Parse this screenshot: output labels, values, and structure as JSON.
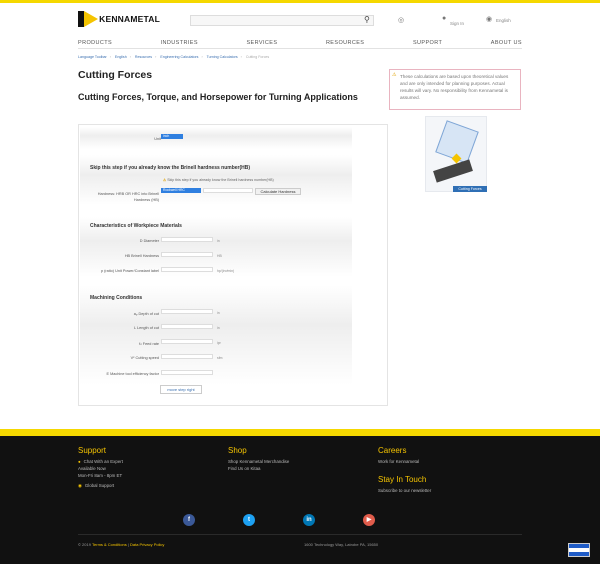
{
  "header": {
    "logo_text": "KENNAMETAL",
    "icon1_label": "",
    "sign_in": "Sign In",
    "language": "English"
  },
  "nav": [
    "PRODUCTS",
    "INDUSTRIES",
    "SERVICES",
    "RESOURCES",
    "SUPPORT",
    "ABOUT US"
  ],
  "breadcrumb": [
    "Language Toolbar",
    "English",
    "Resources",
    "Engineering Calculators",
    "Turning Calculators",
    "Cutting Forces"
  ],
  "page": {
    "title": "Cutting Forces",
    "subtitle": "Cutting Forces, Torque, and Horsepower for Turning Applications"
  },
  "notice": "These calculations are based upon theoretical values and are only intended for planning purposes. Actual results will vary. No responsibility from Kennametal is assumed.",
  "side_caption": "Cutting Forces",
  "form": {
    "unit_label": "Unit",
    "unit_value": "inch",
    "skip_heading": "Skip this step if you already know the Brinell hardness number(HB)",
    "skip_warning": "Skip this step if you already know the Brinell hardness number(HB)",
    "hardness_label": "Hardness: HRB OR HRC into Brinell Hardness (HB)",
    "hardness_select": "Rockwell HRC",
    "calc_button": "Calculate Hardness",
    "workpiece_heading": "Characteristics of Workpiece Materials",
    "diameter_label": "D Diameter",
    "diameter_unit": "in",
    "hb_label": "HB Brinell Hardness",
    "hb_unit": "HB",
    "power_label": "p (ratio) Unit Power/Constant label",
    "power_unit": "hp/(in³/min)",
    "machining_heading": "Machining Conditions",
    "depth_label": "aₚ Depth of cut",
    "depth_unit": "in",
    "length_label": "L Length of cut",
    "length_unit": "in",
    "feed_label": "fₙ Feed rate",
    "feed_unit": "ipr",
    "speed_label": "Vᶜ Cutting speed",
    "speed_unit": "sfm",
    "efficiency_label": "E Machine tool efficiency factor",
    "next_button": "move step right"
  },
  "footer": {
    "support_head": "Support",
    "chat": "Chat With an Expert",
    "available": "Available Now",
    "hours": "Mon-Fri 8am - 8pm ET",
    "global": "Global Support",
    "shop_head": "Shop",
    "shop_merch": "Shop Kennametal Merchandise",
    "find_us": "Find Us on Kitaa",
    "careers_head": "Careers",
    "work": "Work for Kennametal",
    "touch_head": "Stay In Touch",
    "subscribe": "Subscribe to our newsletter",
    "copyright": "© 2019",
    "terms": "Terms & Conditions",
    "privacy": "Data Privacy Policy",
    "address": "1600 Technology Way, Latrobe PA, 15650"
  },
  "colors": {
    "brand_yellow": "#f5d800",
    "link_blue": "#3a6fb0",
    "footer_bg": "#111111"
  },
  "icons": [
    "search-icon",
    "globe-icon",
    "user-icon",
    "language-icon",
    "warning-icon",
    "chat-icon",
    "facebook-icon",
    "twitter-icon",
    "linkedin-icon",
    "youtube-icon"
  ]
}
